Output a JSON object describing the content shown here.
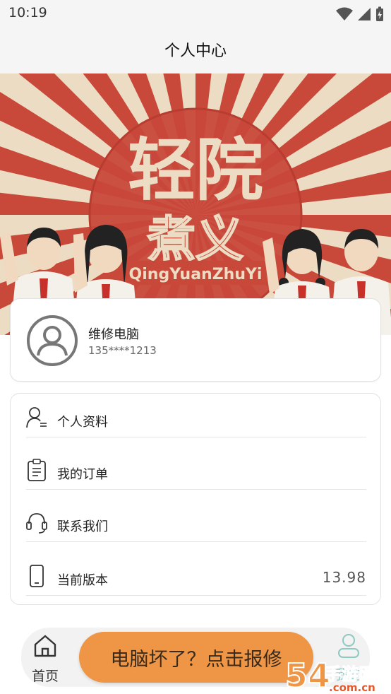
{
  "status_bar": {
    "time": "10:19"
  },
  "header": {
    "title": "个人中心"
  },
  "banner": {
    "title_main": "轻院",
    "title_sub": "煮义",
    "pinyin": "QingYuanZhuYi"
  },
  "profile": {
    "name": "维修电脑",
    "phone": "135****1213"
  },
  "menu": {
    "items": [
      {
        "label": "个人资料",
        "icon": "user-profile-icon"
      },
      {
        "label": "我的订单",
        "icon": "clipboard-icon"
      },
      {
        "label": "联系我们",
        "icon": "headset-icon"
      },
      {
        "label": "当前版本",
        "icon": "phone-icon",
        "value": "13.98"
      }
    ]
  },
  "bottom_nav": {
    "home_label": "首页",
    "mine_label": "我的",
    "repair_button": "电脑坏了？点击报修"
  },
  "watermark": {
    "text": "5419手游网",
    "url_text": ".com.cn"
  },
  "colors": {
    "accent": "#ee9546",
    "banner_red": "#c8483a",
    "banner_cream": "#ecdcc3",
    "active_tab": "#8fc8c0"
  }
}
